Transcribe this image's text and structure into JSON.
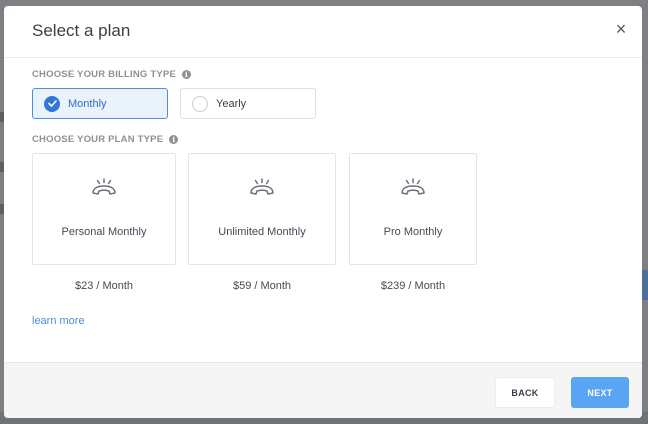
{
  "modal": {
    "title": "Select a plan",
    "close_glyph": "×"
  },
  "billing": {
    "label": "CHOOSE YOUR BILLING TYPE",
    "options": [
      {
        "label": "Monthly",
        "selected": true
      },
      {
        "label": "Yearly",
        "selected": false
      }
    ]
  },
  "plans": {
    "label": "CHOOSE YOUR PLAN TYPE",
    "items": [
      {
        "name": "Personal Monthly",
        "price": "$23 / Month",
        "icon": "ringing-phone-icon"
      },
      {
        "name": "Unlimited Monthly",
        "price": "$59 / Month",
        "icon": "ringing-phone-icon"
      },
      {
        "name": "Pro Monthly",
        "price": "$239 / Month",
        "icon": "ringing-phone-icon"
      }
    ]
  },
  "learn_more": "learn more",
  "footer": {
    "back_label": "BACK",
    "next_label": "NEXT"
  },
  "colors": {
    "accent": "#2f78d6",
    "next_button": "#5aa4f4",
    "link": "#4a8fd8"
  }
}
